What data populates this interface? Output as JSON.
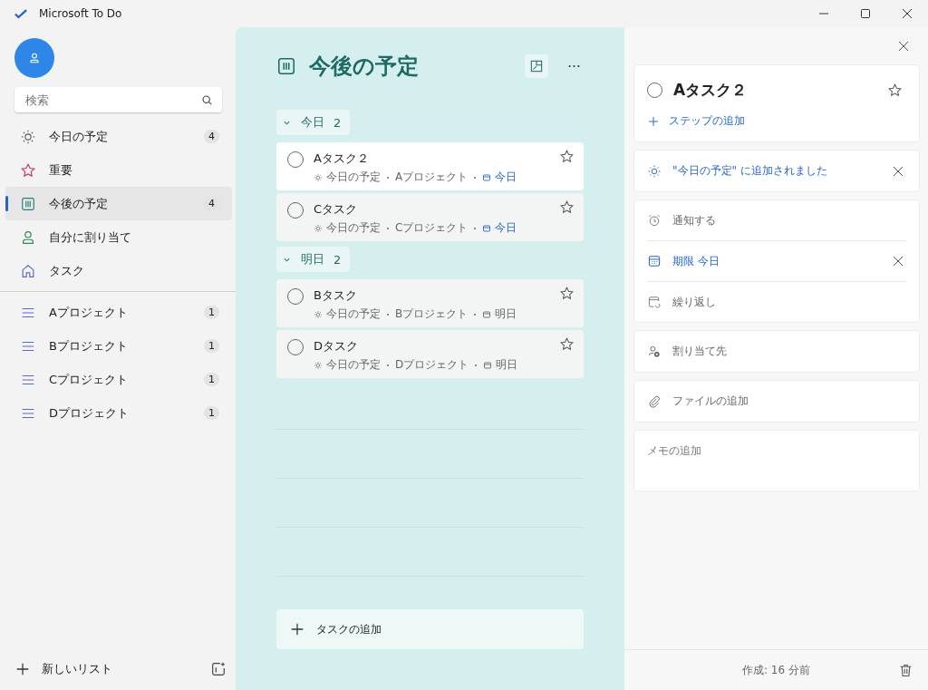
{
  "window": {
    "title": "Microsoft To Do"
  },
  "sidebar": {
    "search": {
      "placeholder": "検索"
    },
    "nav": [
      {
        "kind": "sun",
        "label": "今日の予定",
        "count": "4",
        "selected": false
      },
      {
        "kind": "star",
        "label": "重要",
        "selected": false
      },
      {
        "kind": "calendar",
        "label": "今後の予定",
        "count": "4",
        "selected": true
      },
      {
        "kind": "person",
        "label": "自分に割り当て",
        "selected": false
      },
      {
        "kind": "home",
        "label": "タスク",
        "selected": false
      }
    ],
    "lists": [
      {
        "label": "Aプロジェクト",
        "count": "1",
        "selected": false
      },
      {
        "label": "Bプロジェクト",
        "count": "1",
        "selected": false
      },
      {
        "label": "Cプロジェクト",
        "count": "1",
        "selected": false
      },
      {
        "label": "Dプロジェクト",
        "count": "1",
        "selected": false
      }
    ],
    "new_list": "新しいリスト"
  },
  "main": {
    "title": "今後の予定",
    "groups": [
      {
        "label": "今日",
        "count": "2",
        "expanded": true,
        "tasks": [
          {
            "title": "Aタスク２",
            "selected": true,
            "completed": false,
            "starred": false,
            "my_day": "今日の予定",
            "list": "Aプロジェクト",
            "due": "今日",
            "due_today": true
          },
          {
            "title": "Cタスク",
            "selected": false,
            "completed": false,
            "starred": false,
            "my_day": "今日の予定",
            "list": "Cプロジェクト",
            "due": "今日",
            "due_today": true
          }
        ]
      },
      {
        "label": "明日",
        "count": "2",
        "expanded": true,
        "tasks": [
          {
            "title": "Bタスク",
            "selected": false,
            "completed": false,
            "starred": false,
            "my_day": "今日の予定",
            "list": "Bプロジェクト",
            "due": "明日",
            "due_today": false
          },
          {
            "title": "Dタスク",
            "selected": false,
            "completed": false,
            "starred": false,
            "my_day": "今日の予定",
            "list": "Dプロジェクト",
            "due": "明日",
            "due_today": false
          }
        ]
      }
    ],
    "add_task": "タスクの追加"
  },
  "detail": {
    "title": "Aタスク２",
    "completed": false,
    "starred": false,
    "add_step": "ステップの追加",
    "my_day": "\"今日の予定\" に追加されました",
    "options": [
      {
        "kind": "alarm",
        "label": "通知する",
        "set": false
      },
      {
        "kind": "due",
        "label": "期限 今日",
        "set": true
      },
      {
        "kind": "repeat",
        "label": "繰り返し",
        "set": false
      }
    ],
    "assign": "割り当て先",
    "file": "ファイルの追加",
    "note": {
      "placeholder": "メモの追加"
    },
    "created": "作成: 16 分前"
  }
}
